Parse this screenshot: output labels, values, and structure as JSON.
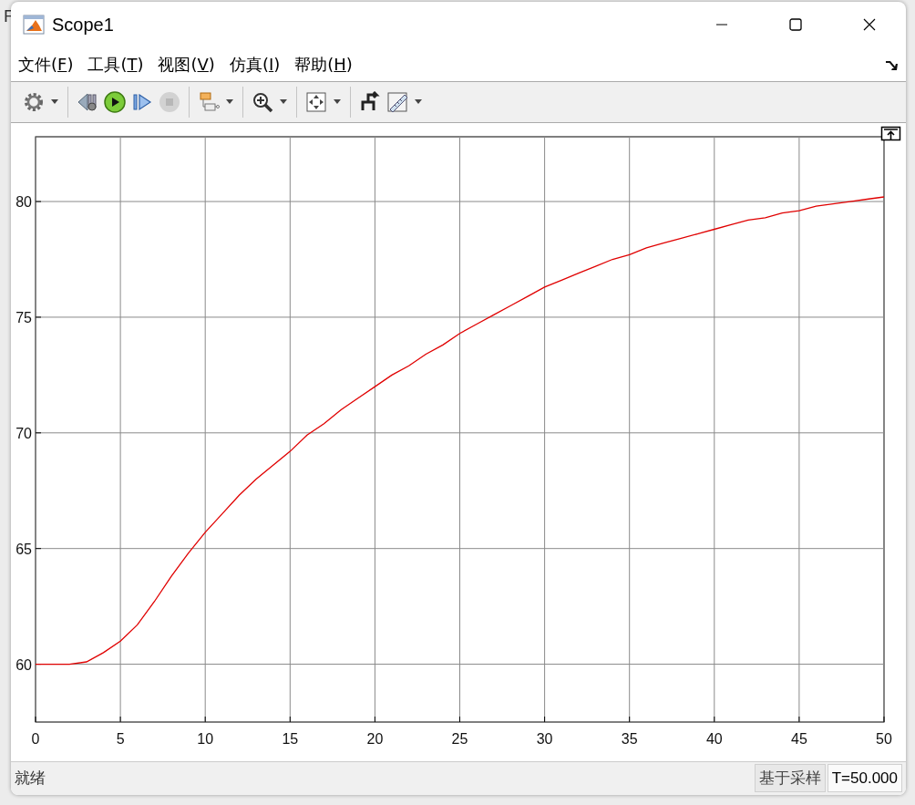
{
  "background_window": {
    "title_fragment": "F"
  },
  "window": {
    "title": "Scope1"
  },
  "menu": [
    {
      "label": "文件(",
      "key": "F",
      "tail": ")"
    },
    {
      "label": "工具(",
      "key": "T",
      "tail": ")"
    },
    {
      "label": "视图(",
      "key": "V",
      "tail": ")"
    },
    {
      "label": "仿真(",
      "key": "I",
      "tail": ")"
    },
    {
      "label": "帮助(",
      "key": "H",
      "tail": ")"
    }
  ],
  "toolbar": [
    {
      "kind": "settings",
      "has_menu": true,
      "disabled": false
    },
    {
      "kind": "separator"
    },
    {
      "kind": "step_back",
      "has_menu": false,
      "disabled": false
    },
    {
      "kind": "run",
      "has_menu": false,
      "disabled": false
    },
    {
      "kind": "step_forward",
      "has_menu": false,
      "disabled": false
    },
    {
      "kind": "stop",
      "has_menu": false,
      "disabled": true
    },
    {
      "kind": "separator"
    },
    {
      "kind": "layout",
      "has_menu": true,
      "disabled": false
    },
    {
      "kind": "separator"
    },
    {
      "kind": "zoom",
      "has_menu": true,
      "disabled": false
    },
    {
      "kind": "separator"
    },
    {
      "kind": "fit",
      "has_menu": true,
      "disabled": false
    },
    {
      "kind": "separator"
    },
    {
      "kind": "trigger",
      "has_menu": false,
      "disabled": false
    },
    {
      "kind": "measure",
      "has_menu": true,
      "disabled": false
    }
  ],
  "plot": {
    "chart_data": {
      "type": "line",
      "grid": true,
      "xlim": [
        0,
        50
      ],
      "ylim": [
        57.5,
        82.8
      ],
      "xticks": [
        0,
        5,
        10,
        15,
        20,
        25,
        30,
        35,
        40,
        45,
        50
      ],
      "yticks": [
        60,
        65,
        70,
        75,
        80
      ],
      "x": [
        0,
        1,
        2,
        3,
        4,
        5,
        6,
        7,
        8,
        9,
        10,
        11,
        12,
        13,
        14,
        15,
        16,
        17,
        18,
        19,
        20,
        21,
        22,
        23,
        24,
        25,
        26,
        27,
        28,
        29,
        30,
        31,
        32,
        33,
        34,
        35,
        36,
        37,
        38,
        39,
        40,
        41,
        42,
        43,
        44,
        45,
        46,
        47,
        48,
        49,
        50
      ],
      "series": [
        {
          "color": "#e00000",
          "values": [
            60,
            60,
            60,
            60.1,
            60.5,
            61,
            61.7,
            62.7,
            63.8,
            64.8,
            65.7,
            66.5,
            67.3,
            68,
            68.6,
            69.2,
            69.9,
            70.4,
            71,
            71.5,
            72,
            72.5,
            72.9,
            73.4,
            73.8,
            74.3,
            74.7,
            75.1,
            75.5,
            75.9,
            76.3,
            76.6,
            76.9,
            77.2,
            77.5,
            77.7,
            78,
            78.2,
            78.4,
            78.6,
            78.8,
            79,
            79.2,
            79.3,
            79.5,
            79.6,
            79.8,
            79.9,
            80,
            80.1,
            80.2
          ]
        }
      ]
    }
  },
  "status_bar": {
    "status": "就绪",
    "mode": "基于采样",
    "time": "T=50.000"
  }
}
